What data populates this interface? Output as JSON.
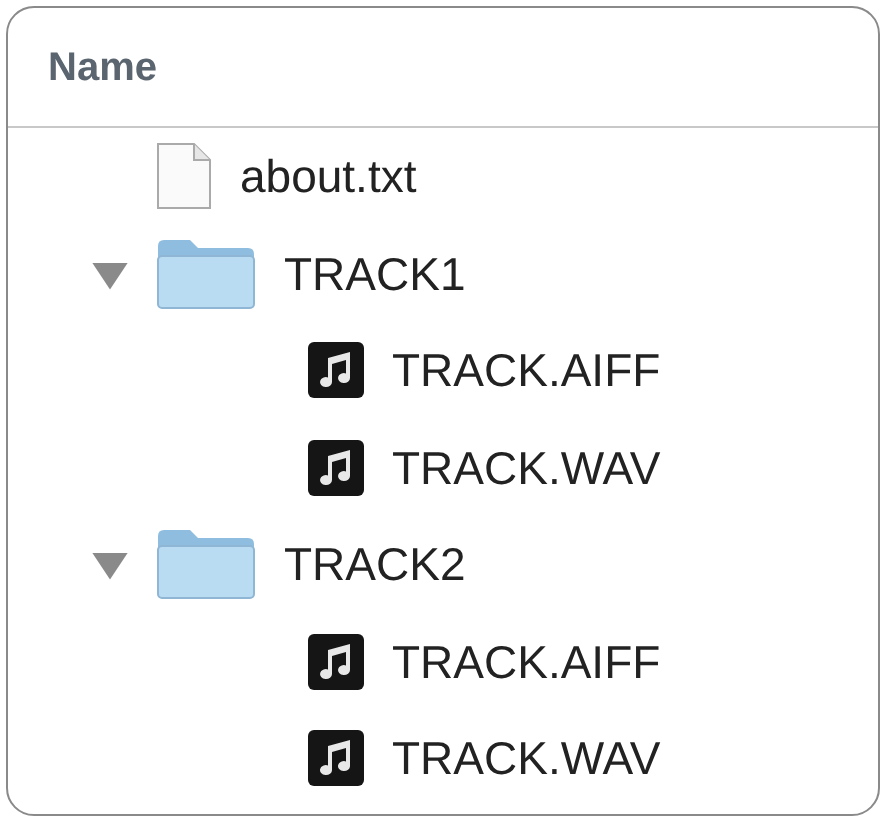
{
  "columns": [
    {
      "label": "Name"
    }
  ],
  "items": [
    {
      "name": "about.txt",
      "kind": "text-file"
    },
    {
      "name": "TRACK1",
      "kind": "folder",
      "expanded": true,
      "children": [
        {
          "name": "TRACK.AIFF",
          "kind": "audio-file"
        },
        {
          "name": "TRACK.WAV",
          "kind": "audio-file"
        }
      ]
    },
    {
      "name": "TRACK2",
      "kind": "folder",
      "expanded": true,
      "children": [
        {
          "name": "TRACK.AIFF",
          "kind": "audio-file"
        },
        {
          "name": "TRACK.WAV",
          "kind": "audio-file"
        }
      ]
    }
  ]
}
